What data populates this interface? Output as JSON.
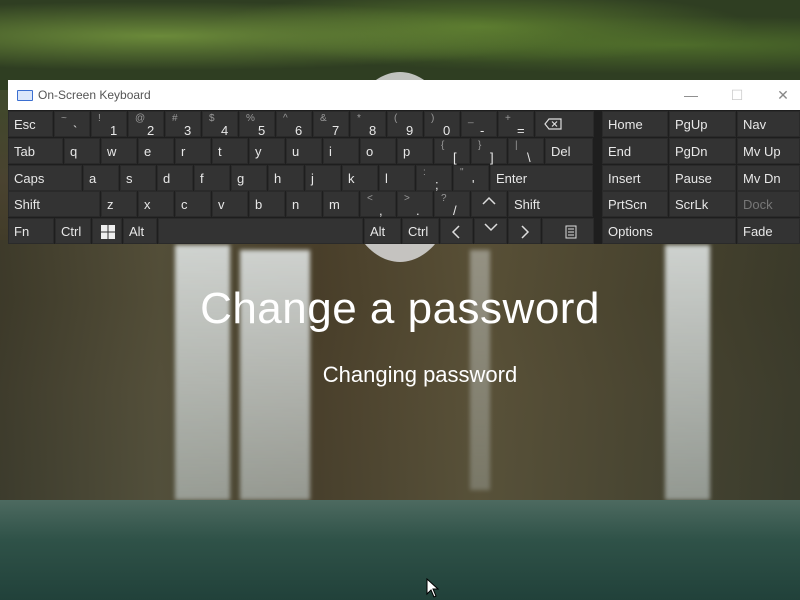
{
  "osk": {
    "title": "On-Screen Keyboard",
    "controls": {
      "minimize": "—",
      "maximize": "☐",
      "close": "✕"
    },
    "row1": [
      {
        "label": "Esc"
      },
      {
        "sup": "~",
        "main": "`"
      },
      {
        "sup": "!",
        "main": "1"
      },
      {
        "sup": "@",
        "main": "2"
      },
      {
        "sup": "#",
        "main": "3"
      },
      {
        "sup": "$",
        "main": "4"
      },
      {
        "sup": "%",
        "main": "5"
      },
      {
        "sup": "^",
        "main": "6"
      },
      {
        "sup": "&",
        "main": "7"
      },
      {
        "sup": "*",
        "main": "8"
      },
      {
        "sup": "(",
        "main": "9"
      },
      {
        "sup": ")",
        "main": "0"
      },
      {
        "sup": "_",
        "main": "-"
      },
      {
        "sup": "+",
        "main": "="
      }
    ],
    "row2": [
      {
        "label": "Tab"
      },
      {
        "label": "q"
      },
      {
        "label": "w"
      },
      {
        "label": "e"
      },
      {
        "label": "r"
      },
      {
        "label": "t"
      },
      {
        "label": "y"
      },
      {
        "label": "u"
      },
      {
        "label": "i"
      },
      {
        "label": "o"
      },
      {
        "label": "p"
      },
      {
        "sup": "{",
        "main": "["
      },
      {
        "sup": "}",
        "main": "]"
      },
      {
        "sup": "|",
        "main": "\\"
      },
      {
        "label": "Del"
      }
    ],
    "row3": [
      {
        "label": "Caps"
      },
      {
        "label": "a"
      },
      {
        "label": "s"
      },
      {
        "label": "d"
      },
      {
        "label": "f"
      },
      {
        "label": "g"
      },
      {
        "label": "h"
      },
      {
        "label": "j"
      },
      {
        "label": "k"
      },
      {
        "label": "l"
      },
      {
        "sup": ":",
        "main": ";"
      },
      {
        "sup": "\"",
        "main": "'"
      },
      {
        "label": "Enter"
      }
    ],
    "row4": [
      {
        "label": "Shift"
      },
      {
        "label": "z"
      },
      {
        "label": "x"
      },
      {
        "label": "c"
      },
      {
        "label": "v"
      },
      {
        "label": "b"
      },
      {
        "label": "n"
      },
      {
        "label": "m"
      },
      {
        "sup": "<",
        "main": ","
      },
      {
        "sup": ">",
        "main": "."
      },
      {
        "sup": "?",
        "main": "/"
      },
      {
        "label": "Shift"
      }
    ],
    "row5": {
      "fn": "Fn",
      "ctrl": "Ctrl",
      "alt": "Alt",
      "alt2": "Alt",
      "ctrl2": "Ctrl"
    },
    "nav": {
      "home": "Home",
      "pgup": "PgUp",
      "nav": "Nav",
      "end": "End",
      "pgdn": "PgDn",
      "mvup": "Mv Up",
      "insert": "Insert",
      "pause": "Pause",
      "mvdn": "Mv Dn",
      "prtscn": "PrtScn",
      "scrlk": "ScrLk",
      "dock": "Dock",
      "options": "Options",
      "fade": "Fade"
    }
  },
  "lock": {
    "title": "Change a password",
    "subtitle": "Changing password"
  }
}
